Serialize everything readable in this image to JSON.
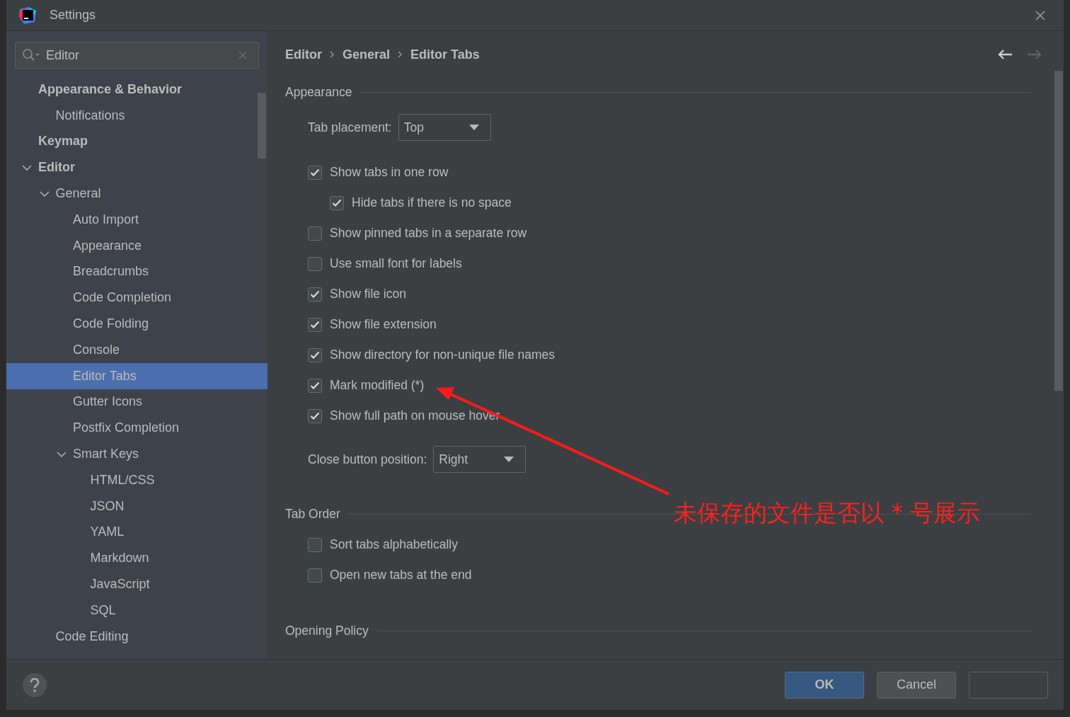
{
  "window": {
    "title": "Settings"
  },
  "search": {
    "value": "Editor"
  },
  "tree": [
    {
      "label": "Appearance & Behavior",
      "selected": false,
      "children": [
        {
          "label": "Notifications",
          "selected": false
        }
      ]
    },
    {
      "label": "Keymap",
      "selected": false
    },
    {
      "label": "Editor",
      "selected": false,
      "expanded": true,
      "children": [
        {
          "label": "General",
          "selected": false,
          "expanded": true,
          "children": [
            {
              "label": "Auto Import",
              "selected": false
            },
            {
              "label": "Appearance",
              "selected": false
            },
            {
              "label": "Breadcrumbs",
              "selected": false
            },
            {
              "label": "Code Completion",
              "selected": false
            },
            {
              "label": "Code Folding",
              "selected": false
            },
            {
              "label": "Console",
              "selected": false
            },
            {
              "label": "Editor Tabs",
              "selected": true
            },
            {
              "label": "Gutter Icons",
              "selected": false
            },
            {
              "label": "Postfix Completion",
              "selected": false
            },
            {
              "label": "Smart Keys",
              "selected": false,
              "expanded": true,
              "children": [
                {
                  "label": "HTML/CSS",
                  "selected": false
                },
                {
                  "label": "JSON",
                  "selected": false
                },
                {
                  "label": "YAML",
                  "selected": false
                },
                {
                  "label": "Markdown",
                  "selected": false
                },
                {
                  "label": "JavaScript",
                  "selected": false
                },
                {
                  "label": "SQL",
                  "selected": false
                }
              ]
            }
          ]
        },
        {
          "label": "Code Editing",
          "selected": false
        }
      ]
    }
  ],
  "breadcrumb": [
    "Editor",
    "General",
    "Editor Tabs"
  ],
  "sections": [
    {
      "title": "Appearance",
      "items": [
        {
          "kind": "dropdown",
          "label": "Tab placement:",
          "value": "Top"
        },
        {
          "kind": "checkbox",
          "label": "Show tabs in one row",
          "checked": true
        },
        {
          "kind": "checkbox",
          "label": "Hide tabs if there is no space",
          "checked": true,
          "nested": true
        },
        {
          "kind": "checkbox",
          "label": "Show pinned tabs in a separate row",
          "checked": false
        },
        {
          "kind": "checkbox",
          "label": "Use small font for labels",
          "checked": false
        },
        {
          "kind": "checkbox",
          "label": "Show file icon",
          "checked": true
        },
        {
          "kind": "checkbox",
          "label": "Show file extension",
          "checked": true
        },
        {
          "kind": "checkbox",
          "label": "Show directory for non-unique file names",
          "checked": true
        },
        {
          "kind": "checkbox",
          "label": "Mark modified (*)",
          "checked": true
        },
        {
          "kind": "checkbox",
          "label": "Show full path on mouse hover",
          "checked": true
        },
        {
          "kind": "dropdown",
          "label": "Close button position:",
          "value": "Right"
        }
      ]
    },
    {
      "title": "Tab Order",
      "items": [
        {
          "kind": "checkbox",
          "label": "Sort tabs alphabetically",
          "checked": false
        },
        {
          "kind": "checkbox",
          "label": "Open new tabs at the end",
          "checked": false
        }
      ]
    },
    {
      "title": "Opening Policy"
    }
  ],
  "buttons": [
    {
      "label": "OK",
      "default": true,
      "disabled": false
    },
    {
      "label": "Cancel",
      "default": false,
      "disabled": false
    },
    {
      "default": false,
      "disabled": true
    }
  ],
  "annotation": {
    "text": "未保存的文件是否以 * 号展示"
  }
}
